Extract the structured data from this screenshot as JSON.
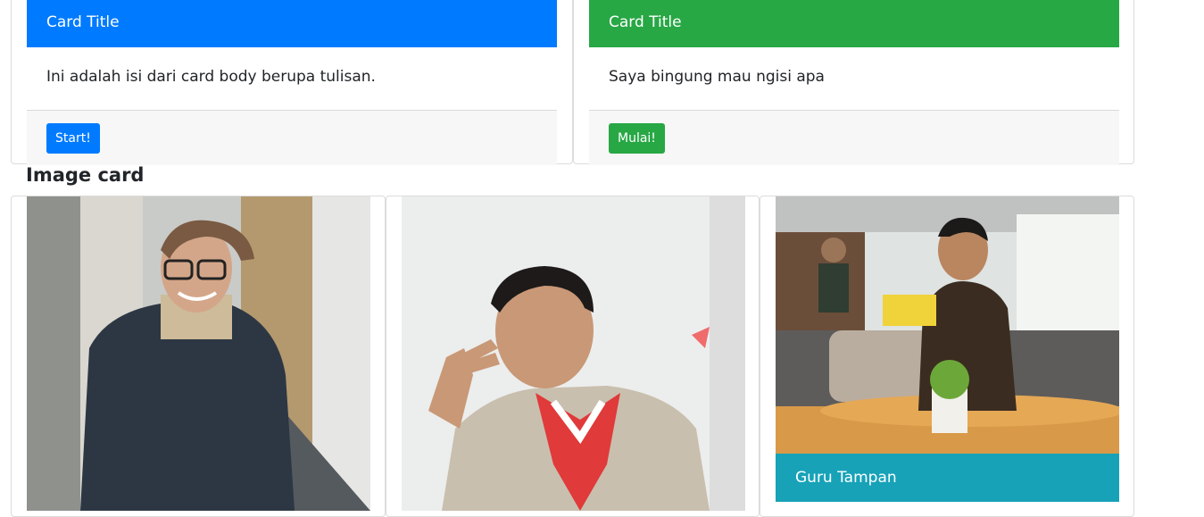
{
  "cards": [
    {
      "title": "Card Title",
      "body": "Ini adalah isi dari card body berupa tulisan.",
      "button": "Start!",
      "color": "#007bff"
    },
    {
      "title": "Card Title",
      "body": "Saya bingung mau ngisi apa",
      "button": "Mulai!",
      "color": "#28a745"
    }
  ],
  "section_title": "Image card",
  "image_cards": [
    {
      "image": "person-photo-1"
    },
    {
      "image": "person-photo-2"
    },
    {
      "image": "person-photo-3",
      "caption": "Guru Tampan",
      "caption_color": "#17a2b8"
    }
  ]
}
